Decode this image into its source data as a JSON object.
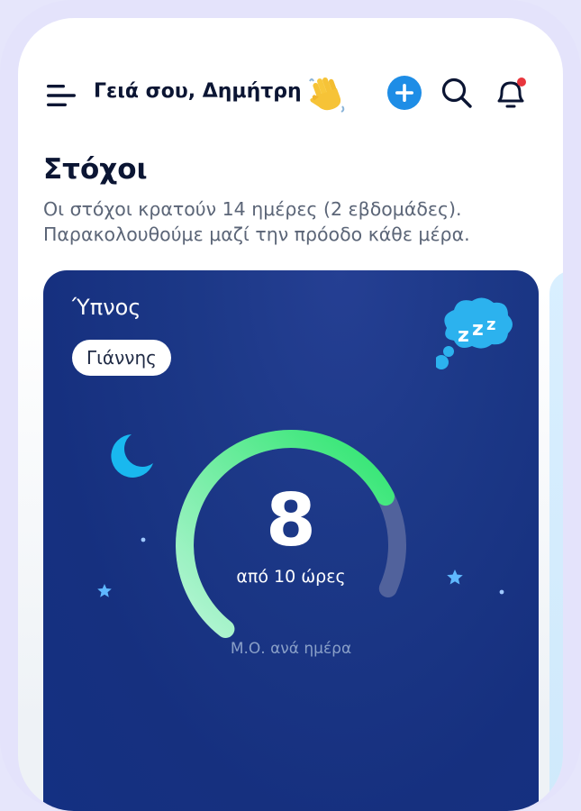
{
  "header": {
    "greeting": "Γειά σου, Δημήτρη",
    "icons": [
      "menu-icon",
      "wave-emoji-icon",
      "add-icon",
      "search-icon",
      "bell-icon"
    ],
    "notification_dot_color": "#e8363d",
    "add_button_color": "#1e8de6"
  },
  "goals": {
    "title": "Στόχοι",
    "description": "Οι στόχοι κρατούν 14 ημέρες (2 εβδομάδες). Παρακολουθούμε μαζί την πρόοδο κάθε μέρα."
  },
  "card": {
    "title": "Ύπνος",
    "person": "Γιάννης",
    "value": "8",
    "target_text": "από 10 ώρες",
    "caption": "Μ.Ο. ανά ημέρα",
    "progress": 0.8,
    "sleep_badge_text": "zzz",
    "colors": {
      "background": "#1a3585",
      "gauge_start": "#b6f5d6",
      "gauge_end": "#2ee56f",
      "gauge_track": "#51629c",
      "moon": "#19b8ef",
      "stars": "#5fb8ff",
      "sleep_badge": "#2cb2ee"
    }
  }
}
